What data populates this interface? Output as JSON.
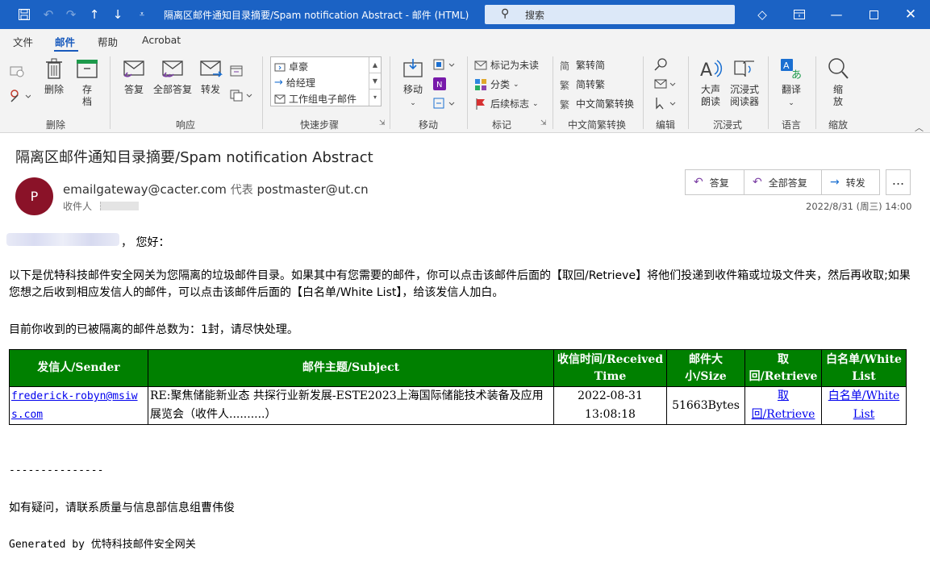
{
  "window": {
    "title": "隔离区邮件通知目录摘要/Spam notification Abstract  -  邮件 (HTML)",
    "search_placeholder": "搜索"
  },
  "menu": {
    "tabs": [
      "文件",
      "邮件",
      "帮助",
      "Acrobat"
    ],
    "active": "邮件"
  },
  "ribbon": {
    "delete_group": {
      "label": "删除",
      "delete": "删除",
      "archive_1": "存",
      "archive_2": "档"
    },
    "respond_group": {
      "label": "响应",
      "reply": "答复",
      "reply_all": "全部答复",
      "forward": "转发"
    },
    "quick_steps": {
      "label": "快速步骤",
      "items": [
        "卓豪",
        "给经理",
        "工作组电子邮件"
      ]
    },
    "move_group": {
      "label": "移动",
      "move": "移动"
    },
    "tags_group": {
      "label": "标记",
      "mark_unread": "标记为未读",
      "categorize": "分类",
      "follow_up": "后续标志"
    },
    "convert_group": {
      "label": "中文简繁转换",
      "to_simplified_from_traditional": "繁转简",
      "to_traditional": "简转繁",
      "convert": "中文简繁转换"
    },
    "edit_group": {
      "label": "编辑"
    },
    "immersive_group": {
      "label": "沉浸式",
      "read_aloud_1": "大声",
      "read_aloud_2": "朗读",
      "immersive_reader_1": "沉浸式",
      "immersive_reader_2": "阅读器"
    },
    "language_group": {
      "label": "语言",
      "translate": "翻译"
    },
    "zoom_group": {
      "label": "缩放",
      "zoom_1": "缩",
      "zoom_2": "放"
    }
  },
  "message": {
    "subject": "隔离区邮件通知目录摘要/Spam notification Abstract",
    "avatar_initial": "P",
    "sender": "emailgateway@cacter.com",
    "on_behalf": "代表",
    "sender_rep": "postmaster@ut.cn",
    "to_label": "收件人",
    "datetime": "2022/8/31 (周三) 14:00",
    "actions": {
      "reply": "答复",
      "reply_all": "全部答复",
      "forward": "转发",
      "more": "..."
    }
  },
  "body": {
    "greeting": "，  您好：",
    "paragraph": "以下是优特科技邮件安全网关为您隔离的垃圾邮件目录。如果其中有您需要的邮件，你可以点击该邮件后面的【取回/Retrieve】将他们投递到收件箱或垃圾文件夹，然后再收取;如果您想之后收到相应发信人的邮件，可以点击该邮件后面的【白名单/White List】，给该发信人加白。",
    "count_line": "目前你收到的已被隔离的邮件总数为：1封，请尽快处理。",
    "table": {
      "headers": [
        "发信人/Sender",
        "邮件主题/Subject",
        "收信时间/Received Time",
        "邮件大小/Size",
        "取回/Retrieve",
        "白名单/White List"
      ],
      "rows": [
        {
          "sender": "frederick-robyn@msiws.com",
          "subject": "RE:聚焦储能新业态 共探行业新发展-ESTE2023上海国际储能技术装备及应用展览会（收件人..........）",
          "received": "2022-08-31 13:08:18",
          "size": "51663Bytes",
          "retrieve": "取回/Retrieve",
          "whitelist": "白名单/White List"
        }
      ]
    },
    "divider": "---------------",
    "contact": "如有疑问，请联系质量与信息部信息组曹伟俊",
    "generated": "Generated by 优特科技邮件安全网关"
  },
  "colors": {
    "title_bar": "#1b62c4",
    "table_header": "#008000",
    "avatar": "#8a1228",
    "link": "#0000ee"
  }
}
